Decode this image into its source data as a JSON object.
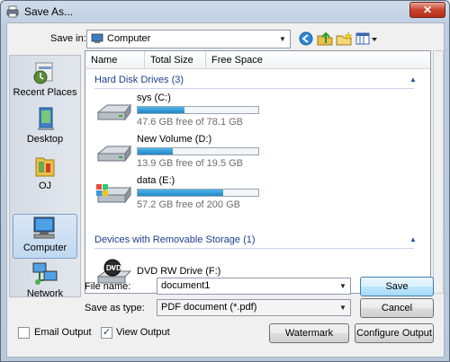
{
  "window": {
    "title": "Save As...",
    "close_glyph": "✕"
  },
  "toolbar": {
    "save_in_label": "Save in:",
    "save_in_value": "Computer",
    "icons": [
      "back-icon",
      "up-folder-icon",
      "new-folder-icon",
      "views-menu-icon"
    ]
  },
  "places": [
    {
      "label": "Recent Places",
      "icon": "recent-places-icon"
    },
    {
      "label": "Desktop",
      "icon": "desktop-icon"
    },
    {
      "label": "OJ",
      "icon": "user-folder-icon"
    },
    {
      "label": "Computer",
      "icon": "computer-icon",
      "selected": true
    },
    {
      "label": "Network",
      "icon": "network-icon"
    }
  ],
  "columns": [
    "Name",
    "Total Size",
    "Free Space"
  ],
  "groups": {
    "hard_disks": {
      "title": "Hard Disk Drives (3)",
      "drives": [
        {
          "name": "sys (C:)",
          "free_text": "47.6 GB free of 78.1 GB",
          "used_fraction": 0.39
        },
        {
          "name": "New Volume (D:)",
          "free_text": "13.9 GB free of 19.5 GB",
          "used_fraction": 0.29
        },
        {
          "name": "data (E:)",
          "free_text": "57.2 GB free of 200 GB",
          "used_fraction": 0.71
        }
      ]
    },
    "removable": {
      "title": "Devices with Removable Storage (1)",
      "drives": [
        {
          "name": "DVD RW Drive (F:)",
          "badge": "DVD"
        }
      ]
    }
  },
  "form": {
    "file_name_label": "File name:",
    "file_name_value": "document1",
    "save_as_type_label": "Save as type:",
    "save_as_type_value": "PDF document (*.pdf)",
    "save_label": "Save",
    "cancel_label": "Cancel"
  },
  "options": {
    "email_output_label": "Email Output",
    "email_output_checked": false,
    "view_output_label": "View Output",
    "view_output_checked": true,
    "check_glyph": "✓",
    "watermark_label": "Watermark",
    "configure_output_label": "Configure Output"
  }
}
